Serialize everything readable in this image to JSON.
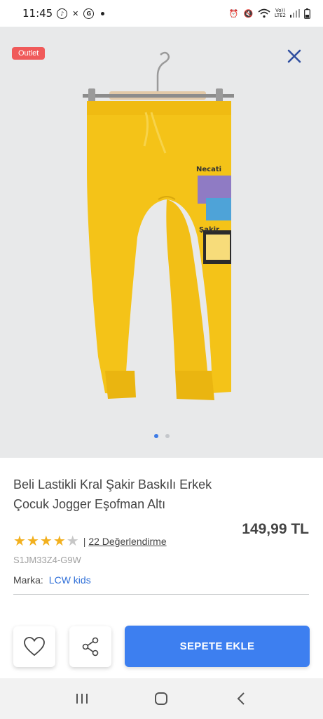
{
  "status_bar": {
    "time": "11:45",
    "network_label_top": "Vo))",
    "network_label_bottom": "LTE2"
  },
  "product": {
    "badge": "Outlet",
    "title": "Beli Lastikli Kral Şakir Baskılı Erkek Çocuk Jogger Eşofman Altı",
    "price": "149,99 TL",
    "rating_value": 4,
    "rating_max": 5,
    "reviews_separator": "|",
    "reviews_label": "22 Değerlendirme",
    "sku": "S1JM33Z4-G9W",
    "brand_label": "Marka:",
    "brand_value": "LCW kids",
    "print_text_1": "Necati",
    "print_text_2": "Şakir",
    "image_pages": 2,
    "image_active_page": 1
  },
  "actions": {
    "add_to_cart": "SEPETE EKLE"
  },
  "icons": {
    "close": "close-icon",
    "favorite": "heart-icon",
    "share": "share-icon",
    "nav_recent": "recent-apps-icon",
    "nav_home": "home-icon",
    "nav_back": "back-icon"
  },
  "colors": {
    "accent": "#3d7ff0",
    "outlet_badge": "#f05a5a",
    "star": "#f2b01e",
    "brand_link": "#2f6fd8",
    "pants": "#f4c318"
  }
}
